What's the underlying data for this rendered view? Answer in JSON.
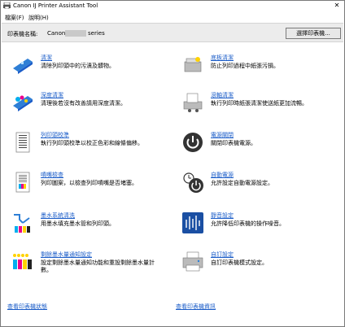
{
  "window": {
    "title": "Canon IJ Printer Assistant Tool",
    "close_label": "✕"
  },
  "menu": {
    "file": "檔案(F)",
    "help": "說明(H)"
  },
  "printer": {
    "label": "印表機名稱:",
    "name": "Canon",
    "suffix": "series",
    "select_button": "選擇印表機..."
  },
  "items": [
    {
      "link": "清潔",
      "desc": "清除列印頭中的污漬及髒物。"
    },
    {
      "link": "底板清潔",
      "desc": "防止列印過程中紙張污損。"
    },
    {
      "link": "深度清潔",
      "desc": "清理後若沒有改善請用深度清潔。"
    },
    {
      "link": "滾軸清潔",
      "desc": "執行列印時紙張清潔使送紙更加流暢。"
    },
    {
      "link": "列印頭校準",
      "desc": "執行列印頭校準以校正色彩和線條偏移。"
    },
    {
      "link": "電源關閉",
      "desc": "關閉印表機電源。"
    },
    {
      "link": "噴嘴檢查",
      "desc": "列印圖案，以檢查列印噴嘴是否堵塞。"
    },
    {
      "link": "自動電源",
      "desc": "允許設定自動電源設定。"
    },
    {
      "link": "墨水系統清洗",
      "desc": "用墨水填充墨水管和列印頭。"
    },
    {
      "link": "靜音設定",
      "desc": "允許降低印表機的操作噪音。"
    },
    {
      "link": "剩餘墨水量通知設定",
      "desc": "設定剩餘墨水量通知功能和重設剩餘墨水量計數。"
    },
    {
      "link": "自訂設定",
      "desc": "自訂印表機模式設定。"
    }
  ],
  "footer": {
    "status": "查看印表機狀態",
    "info": "查看印表機資訊"
  },
  "colors": {
    "link": "#1a5cc8",
    "bar": "#ececec",
    "accent_blue": "#2e7fd6"
  }
}
